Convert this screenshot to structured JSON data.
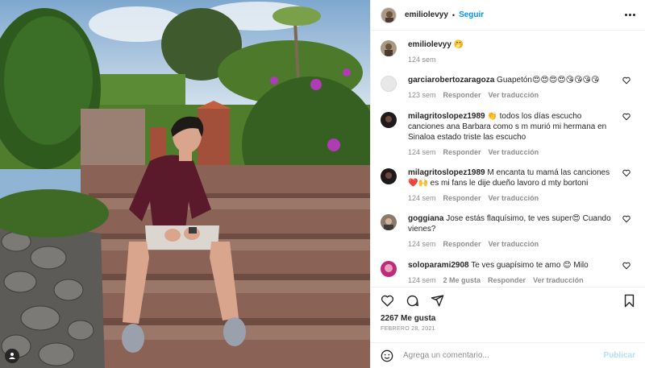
{
  "post": {
    "username": "emiliolevyy",
    "follow_label": "Seguir",
    "separator": "•"
  },
  "caption": {
    "username": "emiliolevyy",
    "text": "🤭",
    "time": "124 sem"
  },
  "comments": [
    {
      "username": "garciarobertozaragoza",
      "text": "Guapetón😍😍😍😍😘😘😘😘",
      "time": "123 sem",
      "reply": "Responder",
      "translate": "Ver traducción"
    },
    {
      "username": "milagritoslopez1989",
      "text": "👏 todos los días escucho canciones ana Barbara como s m murió mi hermana en Sinaloa estado triste las escucho",
      "time": "124 sem",
      "reply": "Responder",
      "translate": "Ver traducción"
    },
    {
      "username": "milagritoslopez1989",
      "text": "M encanta tu mamá las canciones ❤️🙌 es mi fans le dije dueño lavoro d mty bortoni",
      "time": "124 sem",
      "reply": "Responder",
      "translate": "Ver traducción"
    },
    {
      "username": "goggiana",
      "text": "Jose estás flaquísimo, te ves super😍 Cuando vienes?",
      "time": "124 sem",
      "reply": "Responder",
      "translate": "Ver traducción"
    },
    {
      "username": "soloparami2908",
      "text": "Te ves guapísimo te amo 😊 Milo",
      "time": "124 sem",
      "likes": "2 Me gusta",
      "reply": "Responder",
      "translate": "Ver traducción"
    }
  ],
  "stats": {
    "likes": "2267 Me gusta",
    "date": "FEBRERO 28, 2021"
  },
  "composer": {
    "placeholder": "Agrega un comentario...",
    "post_label": "Publicar"
  },
  "colors": {
    "link": "#0095f6",
    "muted": "#8e8e8e",
    "post_disabled": "#b2dffc"
  },
  "icons": [
    "heart-icon",
    "comment-icon",
    "share-icon",
    "save-icon",
    "emoji-icon",
    "user-tag-icon",
    "more-icon"
  ]
}
